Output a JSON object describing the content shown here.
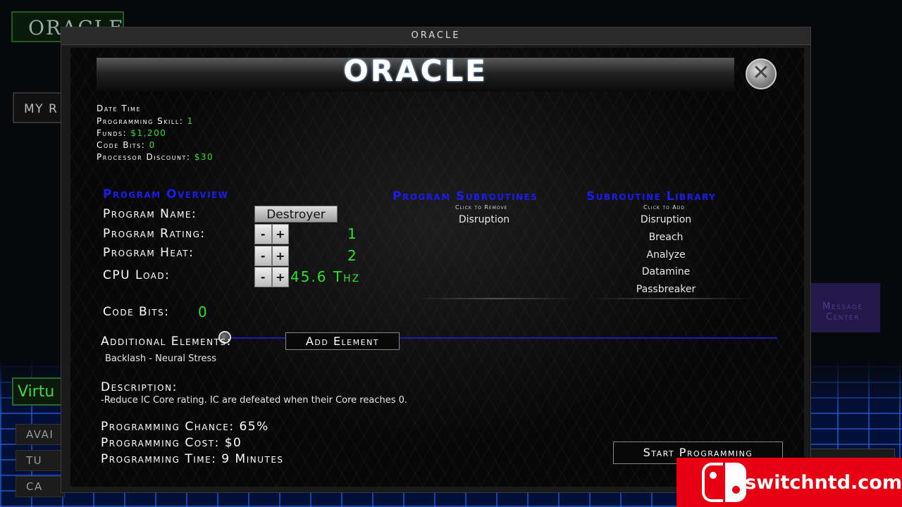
{
  "background": {
    "logo_text": "ORACLE",
    "myr_button": "MY R",
    "virt_tab": "Virtu",
    "side_buttons": [
      "AVAI",
      "TU",
      "CA"
    ],
    "message_center": "Message Center"
  },
  "window": {
    "title": "ORACLE",
    "header_title": "ORACLE",
    "close_icon": "close-icon"
  },
  "stats": {
    "date_time_label": "Date Time",
    "programming_skill_label": "Programming Skill: ",
    "programming_skill_value": "1",
    "funds_label": "Funds: ",
    "funds_value": "$1,200",
    "code_bits_label": "Code Bits: ",
    "code_bits_value": "0",
    "processor_discount_label": "Processor Discount: ",
    "processor_discount_value": "$30"
  },
  "overview": {
    "title": "Program Overview",
    "name_label": "Program Name:",
    "name_value": "Destroyer",
    "rating_label": "Program Rating:",
    "rating_value": "1",
    "heat_label": "Program Heat:",
    "heat_value": "2",
    "cpu_label": "CPU Load:",
    "cpu_value": "45.6 Thz",
    "minus": "-",
    "plus": "+",
    "code_bits_label": "Code Bits:",
    "code_bits_value": "0",
    "code_bits_slider_fraction": 0
  },
  "subroutines": {
    "title": "Program Subroutines",
    "hint": "Click to Remove",
    "items": [
      "Disruption"
    ]
  },
  "library": {
    "title": "Subroutine Library",
    "hint": "Click to Add",
    "items": [
      "Disruption",
      "Breach",
      "Analyze",
      "Datamine",
      "Passbreaker"
    ]
  },
  "elements": {
    "label": "Additional Elements:",
    "add_button": "Add Element",
    "item": "Backlash - Neural Stress"
  },
  "description": {
    "label": "Description:",
    "text": "-Reduce IC Core rating.  IC are defeated when their Core reaches 0."
  },
  "summary": {
    "chance": "Programming Chance: 65%",
    "cost": "Programming Cost: $0",
    "time": "Programming Time: 9 Minutes"
  },
  "actions": {
    "start_button": "Start Programming"
  },
  "watermark": {
    "text": "switchntd.com",
    "color": "#e60012"
  }
}
